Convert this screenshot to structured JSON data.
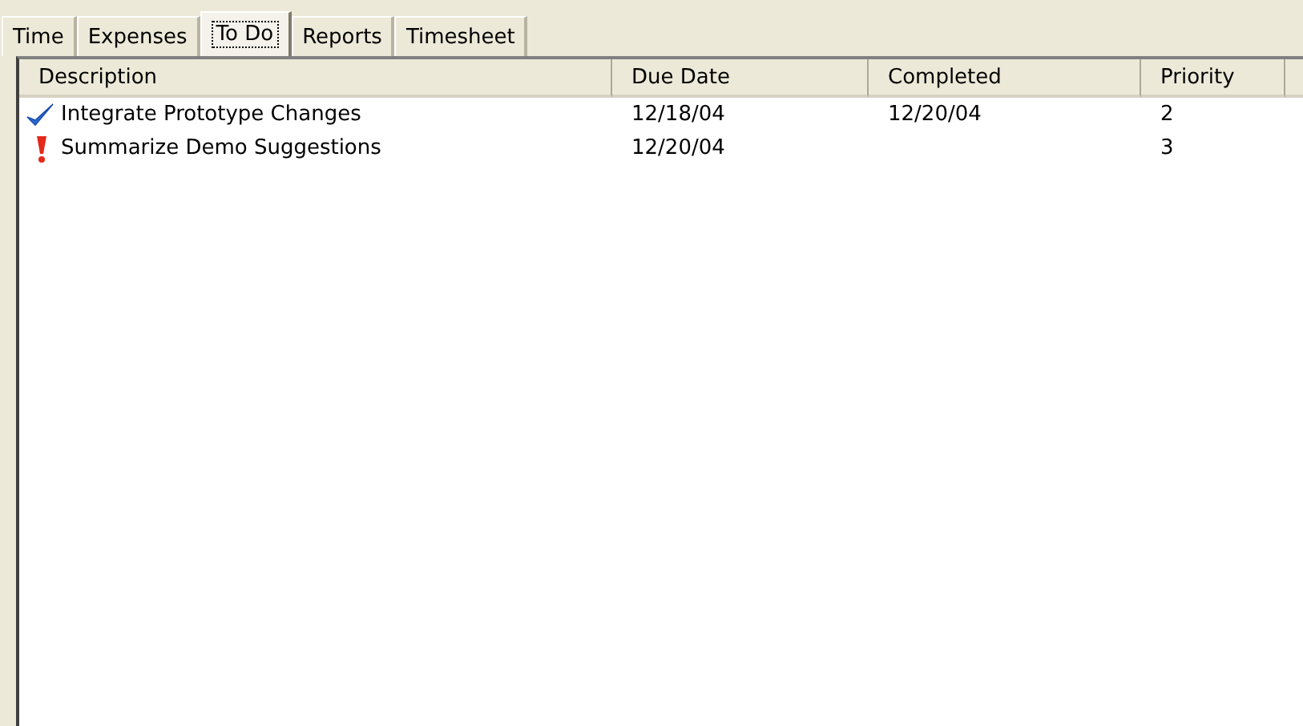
{
  "tabs": [
    {
      "label": "Time",
      "selected": false
    },
    {
      "label": "Expenses",
      "selected": false
    },
    {
      "label": "To Do",
      "selected": true
    },
    {
      "label": "Reports",
      "selected": false
    },
    {
      "label": "Timesheet",
      "selected": false
    }
  ],
  "table": {
    "columns": [
      "Description",
      "Due Date",
      "Completed",
      "Priority"
    ],
    "rows": [
      {
        "completed": true,
        "cells": [
          "Integrate Prototype Changes",
          "12/18/04",
          "12/20/04",
          "2"
        ]
      },
      {
        "completed": false,
        "cells": [
          "Summarize Demo Suggestions",
          "12/20/04",
          "",
          "3"
        ]
      }
    ]
  }
}
